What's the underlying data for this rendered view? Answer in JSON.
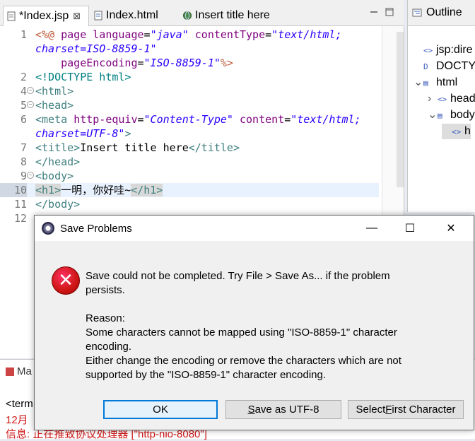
{
  "editor": {
    "tabs": [
      {
        "label": "*Index.jsp",
        "close": "⊠",
        "active": true
      },
      {
        "label": "Index.html",
        "active": false
      },
      {
        "label": "Insert title here",
        "active": false
      }
    ],
    "lines": [
      {
        "n": "1",
        "segs": [
          [
            "dir",
            "<%@ "
          ],
          [
            "attr",
            "page "
          ],
          [
            "attr",
            "language"
          ],
          [
            "text",
            "="
          ],
          [
            "val",
            "\"java\""
          ],
          [
            "text",
            " "
          ],
          [
            "attr",
            "contentType"
          ],
          [
            "text",
            "="
          ],
          [
            "val",
            "\"text/html;"
          ]
        ]
      },
      {
        "n": "",
        "segs": [
          [
            "val",
            "charset=ISO-8859-1\""
          ]
        ]
      },
      {
        "n": "",
        "segs": [
          [
            "text",
            "    "
          ],
          [
            "attr",
            "pageEncoding"
          ],
          [
            "text",
            "="
          ],
          [
            "val",
            "\"ISO-8859-1\""
          ],
          [
            "dir",
            "%>"
          ]
        ]
      },
      {
        "n": "2",
        "segs": [
          [
            "doc",
            "<!DOCTYPE html>"
          ]
        ]
      },
      {
        "n": "4",
        "fold": true,
        "segs": [
          [
            "tag",
            "<html>"
          ]
        ]
      },
      {
        "n": "5",
        "fold": true,
        "segs": [
          [
            "tag",
            "<head>"
          ]
        ]
      },
      {
        "n": "6",
        "segs": [
          [
            "tag",
            "<meta "
          ],
          [
            "attr",
            "http-equiv"
          ],
          [
            "text",
            "="
          ],
          [
            "val",
            "\"Content-Type\""
          ],
          [
            "text",
            " "
          ],
          [
            "attr",
            "content"
          ],
          [
            "text",
            "="
          ],
          [
            "val",
            "\"text/html;"
          ]
        ]
      },
      {
        "n": "",
        "segs": [
          [
            "val",
            "charset=UTF-8\""
          ],
          [
            "tag",
            ">"
          ]
        ]
      },
      {
        "n": "7",
        "segs": [
          [
            "tag",
            "<title>"
          ],
          [
            "text",
            "Insert title here"
          ],
          [
            "tag",
            "</title>"
          ]
        ]
      },
      {
        "n": "8",
        "segs": [
          [
            "tag",
            "</head>"
          ]
        ]
      },
      {
        "n": "9",
        "fold": true,
        "segs": [
          [
            "tag",
            "<body>"
          ]
        ]
      },
      {
        "n": "10",
        "current": true,
        "segs": [
          [
            "tag",
            "<h1>"
          ],
          [
            "text",
            "一明，你好哇~"
          ],
          [
            "tag",
            "</h1>"
          ]
        ]
      },
      {
        "n": "11",
        "segs": [
          [
            "tag",
            "</body>"
          ]
        ]
      },
      {
        "n": "12",
        "segs": []
      }
    ]
  },
  "outline": {
    "title": "Outline",
    "nodes": [
      {
        "label": "jsp:dire",
        "icon": "<>",
        "indent": 0,
        "arrow": ""
      },
      {
        "label": "DOCTY",
        "icon": "D",
        "indent": 0,
        "arrow": ""
      },
      {
        "label": "html",
        "icon": "▤",
        "indent": 0,
        "arrow": "⌄"
      },
      {
        "label": "head",
        "icon": "<>",
        "indent": 1,
        "arrow": "›"
      },
      {
        "label": "body",
        "icon": "▤",
        "indent": 1,
        "arrow": "⌄"
      },
      {
        "label": "h",
        "icon": "<>",
        "indent": 2,
        "arrow": "",
        "selected": true
      }
    ]
  },
  "console": {
    "tab_label": "Ma",
    "line1": "<term",
    "line2": "12月",
    "line3": "信息: 正在推致协议处理器 [\"http-nio-8080\"]"
  },
  "dialog": {
    "title": "Save Problems",
    "message_lines": [
      "Save could not be completed. Try File > Save As... if the problem",
      "persists.",
      "",
      "Reason:",
      "Some characters cannot be mapped using \"ISO-8859-1\" character",
      "encoding.",
      "Either change the encoding or remove the characters which are not",
      "supported by the \"ISO-8859-1\" character encoding."
    ],
    "buttons": {
      "ok": "OK",
      "save_as_pre": "",
      "save_as_u": "S",
      "save_as_post": "ave as UTF-8",
      "select_pre": "Select ",
      "select_u": "F",
      "select_post": "irst Character"
    },
    "controls": {
      "minimize": "—",
      "maximize": "☐",
      "close": "✕"
    },
    "error_glyph": "✕"
  },
  "colors": {
    "tag": "#3f7f7f",
    "attr": "#7f007f",
    "value": "#2a00ff",
    "directive": "#bf5f3f",
    "default_button_border": "#0078d7",
    "error_red": "#d01818"
  }
}
